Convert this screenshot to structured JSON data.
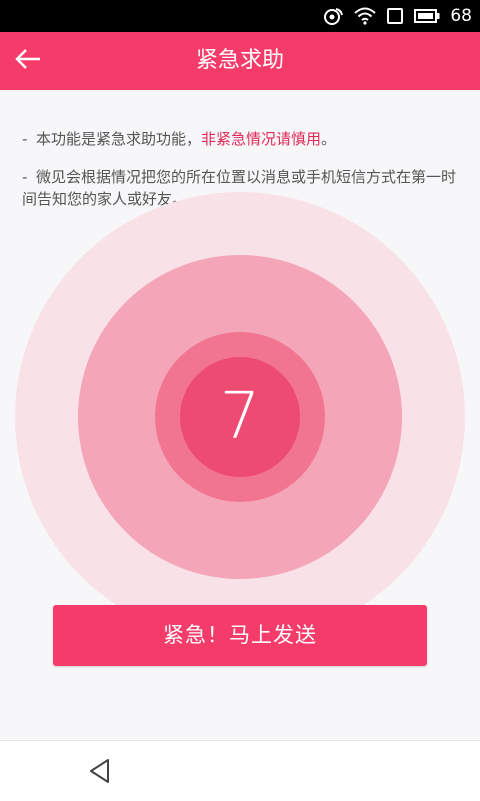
{
  "status_bar": {
    "battery_text": "68",
    "icons": [
      "notification-icon",
      "wifi-icon",
      "sim-icon",
      "battery-icon"
    ]
  },
  "app_bar": {
    "title": "紧急求助",
    "back_icon": "arrow-left-icon"
  },
  "notices": [
    {
      "dash": "-",
      "text": "本功能是紧急求助功能，",
      "warning": "非紧急情况请慎用",
      "suffix": "。"
    },
    {
      "dash": "-",
      "text": "微见会根据情况把您的所在位置以消息或手机短信方式在第一时间告知您的家人或好友。"
    }
  ],
  "countdown": {
    "value": "7"
  },
  "send_button": {
    "label": "紧急！马上发送"
  },
  "nav_bar": {
    "back_icon": "triangle-back-icon"
  },
  "colors": {
    "accent": "#f43b6a",
    "warning_text": "#e02a56",
    "ring_outer": "#f8e1e7",
    "ring_mid": "#f5a5b8",
    "ring_inner": "#f17491",
    "ring_core": "#ee4b72"
  }
}
